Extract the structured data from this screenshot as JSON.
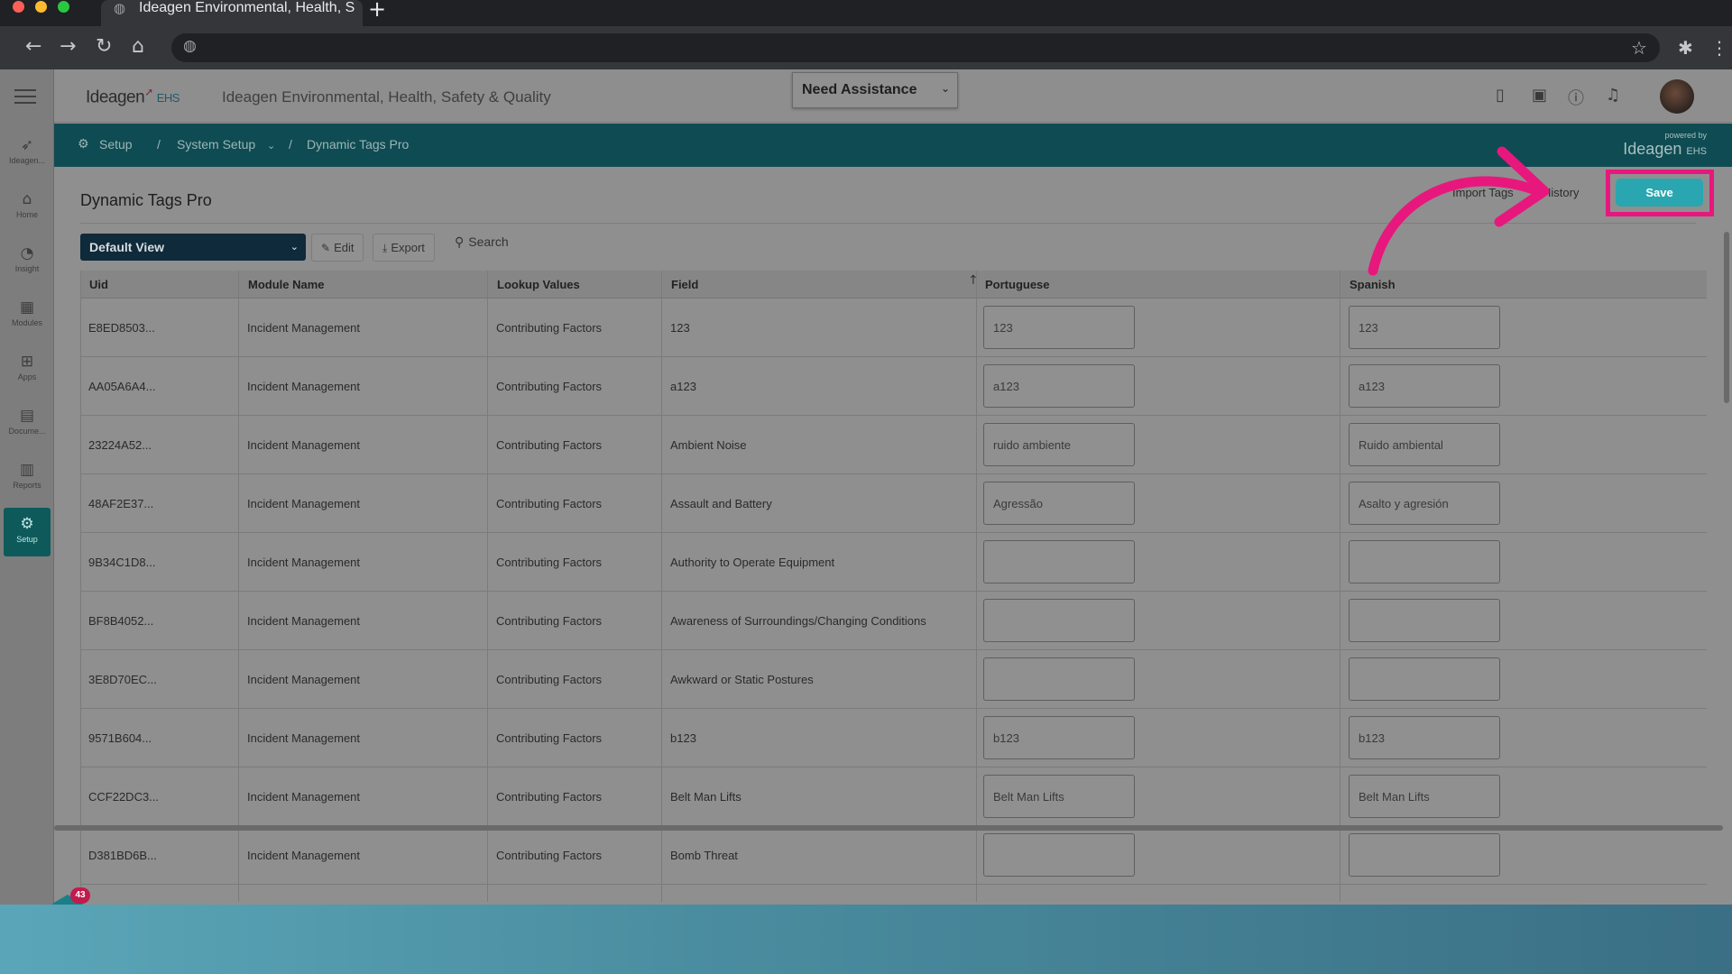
{
  "browser": {
    "tab_title": "Ideagen Environmental, Health, S",
    "new_tab": "+"
  },
  "header": {
    "logo_text": "Ideagen",
    "logo_suffix": "EHS",
    "app_title": "Ideagen Environmental, Health, Safety & Quality",
    "assistance_label": "Need Assistance"
  },
  "sidebar": {
    "items": [
      {
        "label": "Ideagen...",
        "icon": "ideagen-icon"
      },
      {
        "label": "Home",
        "icon": "home-icon"
      },
      {
        "label": "Insight",
        "icon": "insight-icon"
      },
      {
        "label": "Modules",
        "icon": "modules-icon"
      },
      {
        "label": "Apps",
        "icon": "apps-icon"
      },
      {
        "label": "Docume...",
        "icon": "document-icon"
      },
      {
        "label": "Reports",
        "icon": "reports-icon"
      },
      {
        "label": "Setup",
        "icon": "gear-icon"
      }
    ]
  },
  "breadcrumb": {
    "items": [
      "Setup",
      "System Setup",
      "Dynamic Tags Pro"
    ],
    "separator": "/",
    "powered_by": "powered by",
    "powered_logo": "Ideagen",
    "powered_suffix": "EHS"
  },
  "page": {
    "title": "Dynamic Tags Pro",
    "import_tags": "Import Tags",
    "history": "History",
    "save": "Save"
  },
  "toolbar": {
    "view": "Default View",
    "edit": "Edit",
    "export": "Export",
    "search": "Search"
  },
  "table": {
    "columns": [
      "Uid",
      "Module Name",
      "Lookup Values",
      "Field",
      "Portuguese",
      "Spanish"
    ],
    "rows": [
      {
        "uid": "E8ED8503...",
        "module": "Incident Management",
        "lookup": "Contributing Factors",
        "field": "123",
        "pt": "123",
        "es": "123"
      },
      {
        "uid": "AA05A6A4...",
        "module": "Incident Management",
        "lookup": "Contributing Factors",
        "field": "a123",
        "pt": "a123",
        "es": "a123"
      },
      {
        "uid": "23224A52...",
        "module": "Incident Management",
        "lookup": "Contributing Factors",
        "field": "Ambient Noise",
        "pt": "ruido ambiente",
        "es": "Ruido ambiental"
      },
      {
        "uid": "48AF2E37...",
        "module": "Incident Management",
        "lookup": "Contributing Factors",
        "field": "Assault and Battery",
        "pt": "Agressão",
        "es": "Asalto y agresión"
      },
      {
        "uid": "9B34C1D8...",
        "module": "Incident Management",
        "lookup": "Contributing Factors",
        "field": "Authority to Operate Equipment",
        "pt": "",
        "es": ""
      },
      {
        "uid": "BF8B4052...",
        "module": "Incident Management",
        "lookup": "Contributing Factors",
        "field": "Awareness of Surroundings/Changing Conditions",
        "pt": "",
        "es": ""
      },
      {
        "uid": "3E8D70EC...",
        "module": "Incident Management",
        "lookup": "Contributing Factors",
        "field": "Awkward or Static Postures",
        "pt": "",
        "es": ""
      },
      {
        "uid": "9571B604...",
        "module": "Incident Management",
        "lookup": "Contributing Factors",
        "field": "b123",
        "pt": "b123",
        "es": "b123"
      },
      {
        "uid": "CCF22DC3...",
        "module": "Incident Management",
        "lookup": "Contributing Factors",
        "field": "Belt Man Lifts",
        "pt": "Belt Man Lifts",
        "es": "Belt Man Lifts"
      },
      {
        "uid": "D381BD6B...",
        "module": "Incident Management",
        "lookup": "Contributing Factors",
        "field": "Bomb Threat",
        "pt": "",
        "es": ""
      }
    ]
  },
  "notification_badge": {
    "count": "43"
  },
  "colors": {
    "accent": "#2aa6b0",
    "highlight": "#e8177d",
    "crumb_bar": "#0f4b52"
  }
}
